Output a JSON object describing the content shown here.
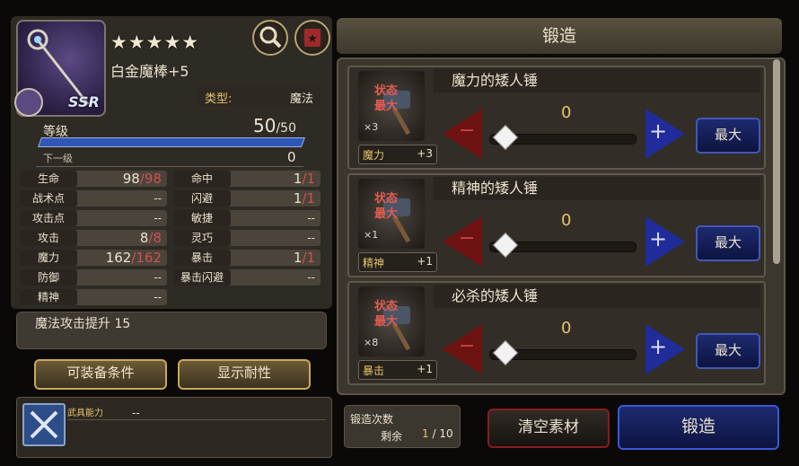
{
  "weapon": {
    "stars": "★★★★★",
    "name": "白金魔棒+5",
    "rarity": "SSR",
    "type_label": "类型:",
    "type_value": "魔法",
    "level_label": "等级",
    "level_value": "50",
    "level_max": "/50",
    "next_label": "下一级",
    "next_value": "0",
    "icons": {
      "search": "magnifier-icon",
      "favorite": "star-badge-icon"
    }
  },
  "stats": [
    {
      "k": "生命",
      "v": "98",
      "m": "/98"
    },
    {
      "k": "命中",
      "v": "1",
      "m": "/1"
    },
    {
      "k": "战术点",
      "v": "--",
      "m": ""
    },
    {
      "k": "闪避",
      "v": "1",
      "m": "/1"
    },
    {
      "k": "攻击点",
      "v": "--",
      "m": ""
    },
    {
      "k": "敏捷",
      "v": "--",
      "m": ""
    },
    {
      "k": "攻击",
      "v": "8",
      "m": "/8"
    },
    {
      "k": "灵巧",
      "v": "--",
      "m": ""
    },
    {
      "k": "魔力",
      "v": "162",
      "m": "/162"
    },
    {
      "k": "暴击",
      "v": "1",
      "m": "/1"
    },
    {
      "k": "防御",
      "v": "--",
      "m": ""
    },
    {
      "k": "暴击闪避",
      "v": "--",
      "m": ""
    },
    {
      "k": "精神",
      "v": "--",
      "m": ""
    }
  ],
  "description": "魔法攻击提升 15",
  "buttons": {
    "conditions": "可装备条件",
    "durability": "显示耐性"
  },
  "ability": {
    "label": "武具能力",
    "value": "--"
  },
  "forge": {
    "title": "锻造",
    "items": [
      {
        "name": "魔力的矮人锤",
        "status": "状态\n最大",
        "count": "×3",
        "stat": "魔力",
        "bonus": "+3",
        "amount": "0",
        "minus": "−",
        "plus": "+",
        "max": "最大"
      },
      {
        "name": "精神的矮人锤",
        "status": "状态\n最大",
        "count": "×1",
        "stat": "精神",
        "bonus": "+1",
        "amount": "0",
        "minus": "−",
        "plus": "+",
        "max": "最大"
      },
      {
        "name": "必杀的矮人锤",
        "status": "状态\n最大",
        "count": "×8",
        "stat": "暴击",
        "bonus": "+1",
        "amount": "0",
        "minus": "−",
        "plus": "+",
        "max": "最大"
      }
    ],
    "counter_label": "锻造次数",
    "remain_label": "剩余",
    "remain_value": "1",
    "remain_max": "/ 10",
    "clear_label": "清空素材",
    "forge_label": "锻造"
  },
  "colors": {
    "accent_gold": "#e6c36c",
    "danger": "#d05050",
    "blue": "#1e2a70"
  }
}
